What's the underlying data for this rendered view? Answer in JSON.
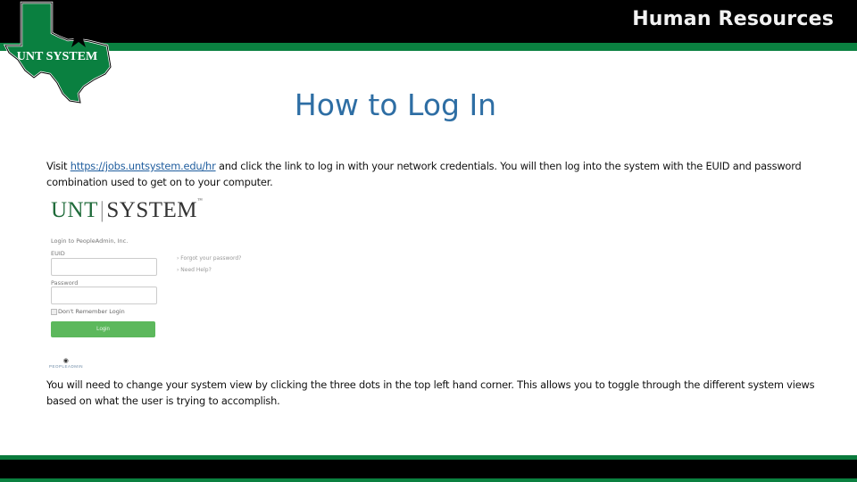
{
  "header": {
    "title": "Human Resources",
    "logo_text": "UNT SYSTEM",
    "colors": {
      "black": "#000000",
      "green": "#0a8040"
    }
  },
  "slide": {
    "title": "How to Log In",
    "paragraph1": {
      "before_link": "Visit ",
      "link_text": "https://jobs.untsystem.edu/hr",
      "after_link": " and click the link to log in with your network credentials. You will then log into the system with the EUID and password combination used to get on to your computer."
    },
    "paragraph2": "You will need to change your system view by clicking the three dots in the top left hand corner. This allows you to toggle through the different system views based on what the user is trying to accomplish."
  },
  "login_screenshot": {
    "brand_left": "UNT",
    "brand_sep": "|",
    "brand_right": "SYSTEM",
    "brand_tm": "™",
    "heading": "Login to PeopleAdmin, Inc.",
    "euid_label": "EUID",
    "euid_value": "",
    "password_label": "Password",
    "password_value": "",
    "remember_label": "Don't Remember Login",
    "login_button": "Login",
    "forgot_link": "› Forgot your password?",
    "help_link": "› Need Help?",
    "footer_logo": "PEOPLEADMIN"
  }
}
